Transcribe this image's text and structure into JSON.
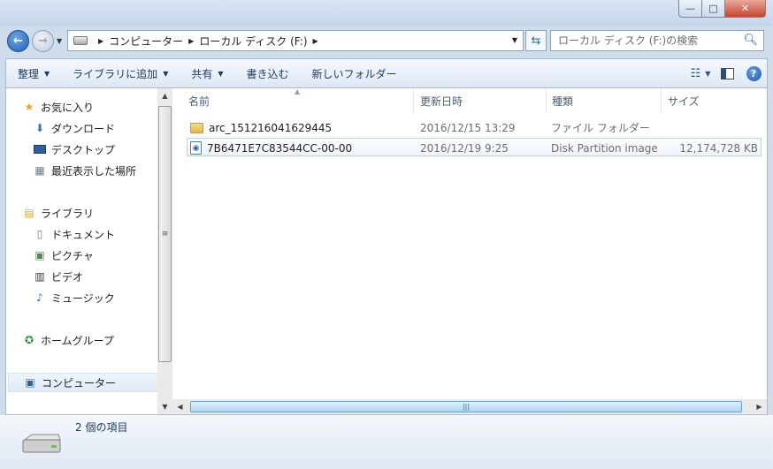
{
  "window": {
    "controls": {
      "minimize": "—",
      "maximize": "□",
      "close": "✕"
    }
  },
  "nav": {
    "back_icon": "back-arrow-icon",
    "forward_icon": "forward-arrow-icon",
    "breadcrumb": [
      "コンピューター",
      "ローカル ディスク (F:)"
    ],
    "search_placeholder": "ローカル ディスク (F:)の検索"
  },
  "toolbar": {
    "organize": "整理",
    "add_to_library": "ライブラリに追加",
    "share": "共有",
    "burn": "書き込む",
    "new_folder": "新しいフォルダー"
  },
  "sidebar": {
    "favorites": {
      "label": "お気に入り",
      "items": [
        "ダウンロード",
        "デスクトップ",
        "最近表示した場所"
      ]
    },
    "libraries": {
      "label": "ライブラリ",
      "items": [
        "ドキュメント",
        "ピクチャ",
        "ビデオ",
        "ミュージック"
      ]
    },
    "homegroup": "ホームグループ",
    "computer": "コンピューター"
  },
  "columns": {
    "name": "名前",
    "modified": "更新日時",
    "type": "種類",
    "size": "サイズ"
  },
  "files": [
    {
      "name": "arc_151216041629445",
      "modified": "2016/12/15 13:29",
      "type": "ファイル フォルダー",
      "size": "",
      "icon": "folder-icon"
    },
    {
      "name": "7B6471E7C83544CC-00-00",
      "modified": "2016/12/19 9:25",
      "type": "Disk Partition image",
      "size": "12,174,728 KB",
      "icon": "disk-image-icon"
    }
  ],
  "status": {
    "item_count": "2 個の項目"
  },
  "colors": {
    "accent": "#1f5fb6",
    "folder": "#e1b652",
    "chrome": "#cfdcec"
  }
}
